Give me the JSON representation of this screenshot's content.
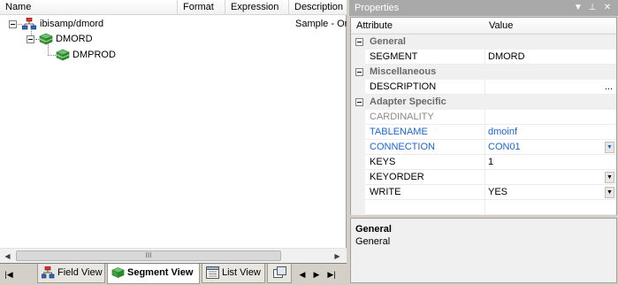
{
  "columns": {
    "name": "Name",
    "format": "Format",
    "expression": "Expression",
    "description": "Description"
  },
  "tree": {
    "root": {
      "label": "ibisamp/dmord",
      "description": "Sample - Or"
    },
    "segment": {
      "label": "DMORD"
    },
    "child": {
      "label": "DMPROD"
    }
  },
  "scrollbar": {
    "thumb_grip": "III"
  },
  "tabs": [
    {
      "label": "Field View",
      "icon": "field-view-icon"
    },
    {
      "label": "Segment View",
      "icon": "segment-view-icon",
      "active": true
    },
    {
      "label": "List View",
      "icon": "list-view-icon"
    }
  ],
  "properties": {
    "title": "Properties",
    "headers": {
      "attribute": "Attribute",
      "value": "Value"
    },
    "categories": {
      "general": "General",
      "misc": "Miscellaneous",
      "adapter": "Adapter Specific"
    },
    "rows": {
      "segment": {
        "name": "SEGMENT",
        "value": "DMORD"
      },
      "description": {
        "name": "DESCRIPTION",
        "value": "",
        "button": "..."
      },
      "cardinality": {
        "name": "CARDINALITY",
        "value": ""
      },
      "tablename": {
        "name": "TABLENAME",
        "value": "dmoinf"
      },
      "connection": {
        "name": "CONNECTION",
        "value": "CON01"
      },
      "keys": {
        "name": "KEYS",
        "value": "1"
      },
      "keyorder": {
        "name": "KEYORDER",
        "value": ""
      },
      "write": {
        "name": "WRITE",
        "value": "YES"
      }
    },
    "help": {
      "title": "General",
      "text": "General"
    }
  },
  "colors": {
    "link_blue": "#1c64d6",
    "title_bar": "#a9a9a9",
    "segment_green": "#3ca03c"
  }
}
